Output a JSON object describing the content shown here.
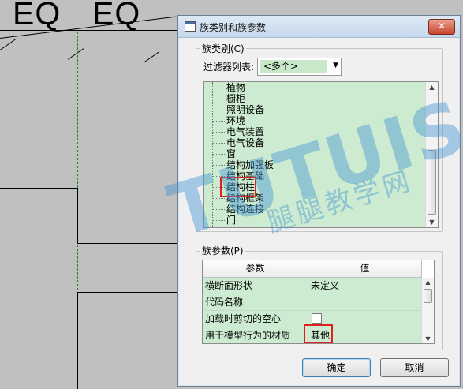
{
  "canvas": {
    "dim_label_left": "EQ",
    "dim_label_right": "EQ"
  },
  "dialog": {
    "title": "族类别和族参数",
    "close_label": "✕",
    "category_group_label": "族类别(C)",
    "filter_label": "过滤器列表:",
    "filter_value": "<多个>",
    "categories": [
      "植物",
      "橱柜",
      "照明设备",
      "环境",
      "电气装置",
      "电气设备",
      "窗",
      "结构加强板",
      "结构基础",
      "结构柱",
      "结构框架",
      "结构连接",
      "门"
    ],
    "selected_category": "结构柱",
    "params_group_label": "族参数(P)",
    "params_headers": {
      "param": "参数",
      "value": "值"
    },
    "params": [
      {
        "name": "横断面形状",
        "value": "未定义"
      },
      {
        "name": "代码名称",
        "value": ""
      },
      {
        "name": "加载时剪切的空心",
        "value": ""
      },
      {
        "name": "用于模型行为的材质",
        "value": "其他"
      }
    ],
    "ok_label": "确定",
    "cancel_label": "取消"
  },
  "watermark": {
    "logo": "TUTUISOFT",
    "subtitle": "腿腿教学网"
  },
  "colors": {
    "highlight_red": "#e02020",
    "list_green": "#ccebd0",
    "watermark_blue": "#4696d2"
  }
}
